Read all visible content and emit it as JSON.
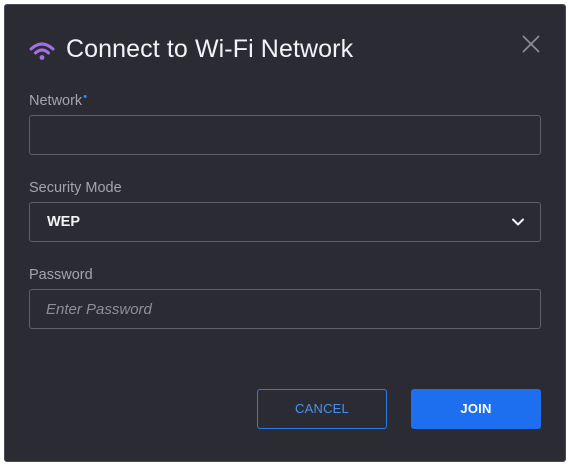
{
  "dialog": {
    "title": "Connect to Wi-Fi Network",
    "icon": "wifi-icon",
    "accent_color": "#a46ee8",
    "close_icon": "close-icon"
  },
  "network": {
    "label": "Network",
    "required_marker": "•",
    "value": ""
  },
  "security": {
    "label": "Security Mode",
    "value": "WEP",
    "icon": "chevron-down-icon"
  },
  "password": {
    "label": "Password",
    "value": "",
    "placeholder": "Enter Password"
  },
  "actions": {
    "cancel_label": "CANCEL",
    "join_label": "JOIN",
    "primary_color": "#1e6ff0"
  }
}
